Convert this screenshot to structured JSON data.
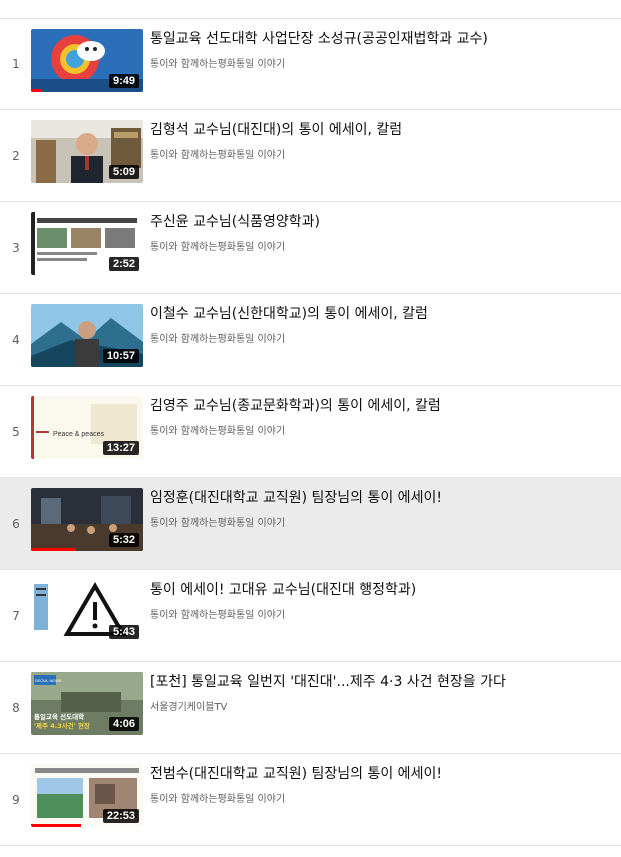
{
  "playlist": [
    {
      "index": "1",
      "title": "통일교육 선도대학 사업단장 소성규(공공인재법학과 교수)",
      "channel": "통이와 함께하는평화통일 이야기",
      "duration": "9:49",
      "watched": 0.1
    },
    {
      "index": "2",
      "title": "김형석 교수님(대진대)의 통이 에세이, 칼럼",
      "channel": "통이와 함께하는평화통일 이야기",
      "duration": "5:09",
      "watched": 0
    },
    {
      "index": "3",
      "title": "주신윤 교수님(식품영양학과)",
      "channel": "통이와 함께하는평화통일 이야기",
      "duration": "2:52",
      "watched": 0
    },
    {
      "index": "4",
      "title": "이철수 교수님(신한대학교)의 통이 에세이, 칼럼",
      "channel": "통이와 함께하는평화통일 이야기",
      "duration": "10:57",
      "watched": 0
    },
    {
      "index": "5",
      "title": "김영주 교수님(종교문화학과)의 통이 에세이, 칼럼",
      "channel": "통이와 함께하는평화통일 이야기",
      "duration": "13:27",
      "watched": 0
    },
    {
      "index": "6",
      "title": "임정훈(대진대학교 교직원) 팀장님의 통이 에세이!",
      "channel": "통이와 함께하는평화통일 이야기",
      "duration": "5:32",
      "watched": 0.4,
      "active": true
    },
    {
      "index": "7",
      "title": "통이 에세이! 고대유 교수님(대진대 행정학과)",
      "channel": "통이와 함께하는평화통일 이야기",
      "duration": "5:43",
      "watched": 0
    },
    {
      "index": "8",
      "title": "[포천] 통일교육 일번지 '대진대'...제주 4·3 사건 현장을 가다",
      "channel": "서울경기케이블TV",
      "duration": "4:06",
      "watched": 0
    },
    {
      "index": "9",
      "title": "전범수(대진대학교 교직원) 팀장님의 통이 에세이!",
      "channel": "통이와 함께하는평화통일 이야기",
      "duration": "22:53",
      "watched": 0.45
    }
  ],
  "thumb_text": {
    "peace": "Peace & peaces",
    "news_badge": "SEOUL NEWS",
    "caption_line1": "통일교육 선도대학",
    "caption_line2": "'제주 4.3사건' 현장"
  },
  "colors": {
    "progress": "#ff0000",
    "active_row": "#ebebeb",
    "text": "#0f0f0f",
    "meta": "#606060"
  }
}
